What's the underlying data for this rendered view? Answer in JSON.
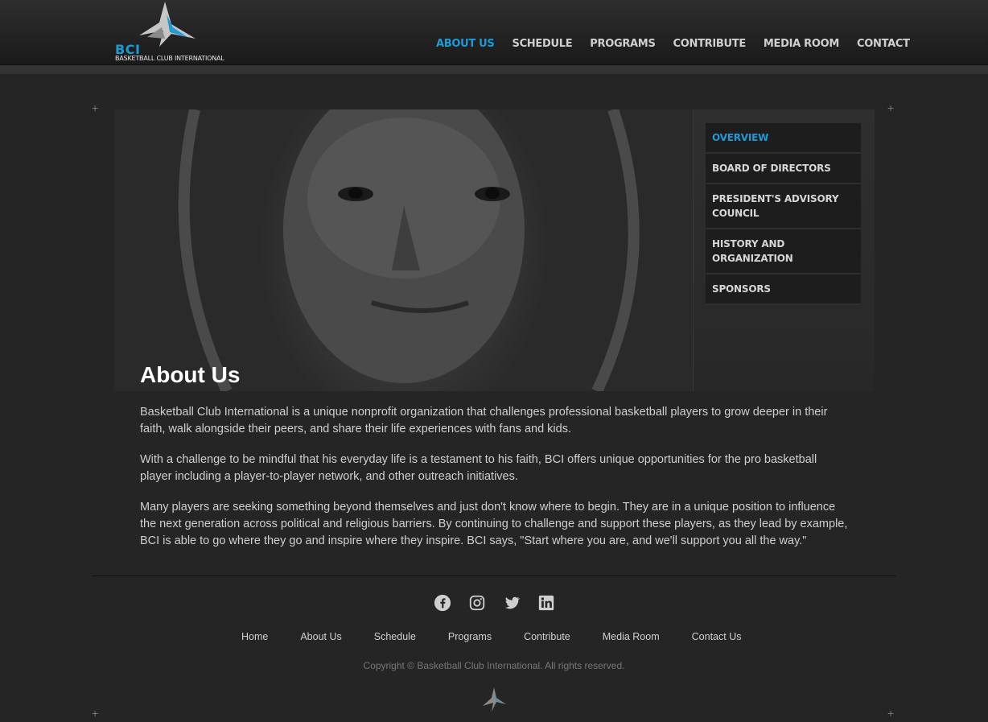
{
  "brand": {
    "logo_text": "BCI",
    "logo_subtitle": "BASKETBALL CLUB INTERNATIONAL",
    "accent": "#1e9ad6"
  },
  "nav": {
    "items": [
      "ABOUT US",
      "SCHEDULE",
      "PROGRAMS",
      "CONTRIBUTE",
      "MEDIA ROOM",
      "CONTACT"
    ],
    "active_index": 0
  },
  "subnav": {
    "items": [
      "OVERVIEW",
      "BOARD OF DIRECTORS",
      "PRESIDENT'S ADVISORY COUNCIL",
      "HISTORY AND ORGANIZATION",
      "SPONSORS"
    ],
    "active_index": 0
  },
  "page": {
    "title": "About Us",
    "paragraphs": [
      "Basketball Club International is a unique nonprofit organization that challenges professional basketball players to grow deeper in their faith, walk alongside their peers, and share their life experiences with fans and kids.",
      "With a challenge to be mindful that his everyday life is a testament to his faith, BCI offers unique opportunities for the pro basketball player including a player-to-player network, and other outreach initiatives.",
      "Many players are seeking something beyond themselves and just don't know where to begin. They are in a unique position to influence the next generation across political and religious barriers. By continuing to challenge and support these players, as they lead by example, BCI is able to go where they go and inspire where they inspire. BCI says, \"Start where you are, and we'll support you all the way.\""
    ]
  },
  "footer": {
    "social_icons": [
      "facebook-icon",
      "instagram-icon",
      "twitter-icon",
      "linkedin-icon"
    ],
    "links": [
      "Home",
      "About Us",
      "Schedule",
      "Programs",
      "Contribute",
      "Media Room",
      "Contact Us"
    ],
    "copyright": "Copyright © Basketball Club International. All rights reserved."
  }
}
